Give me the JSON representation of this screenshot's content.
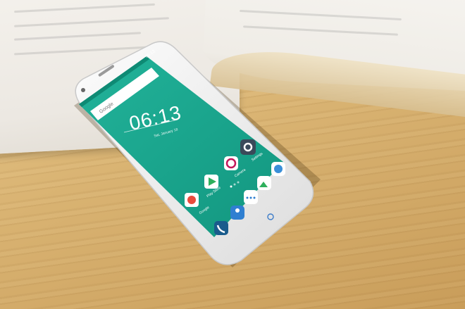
{
  "scene": {
    "status_time": "06:13",
    "search_placeholder": "Google",
    "clock_time": "06:13",
    "date_text": "Sat, January 18",
    "apps": {
      "google": "Google",
      "play_store": "Play Store",
      "camera": "Camera",
      "settings": "Settings"
    },
    "colors": {
      "screen_teal": "#1aa88f",
      "phone_white": "#f4f4f4",
      "wood": "#d6b070"
    }
  }
}
